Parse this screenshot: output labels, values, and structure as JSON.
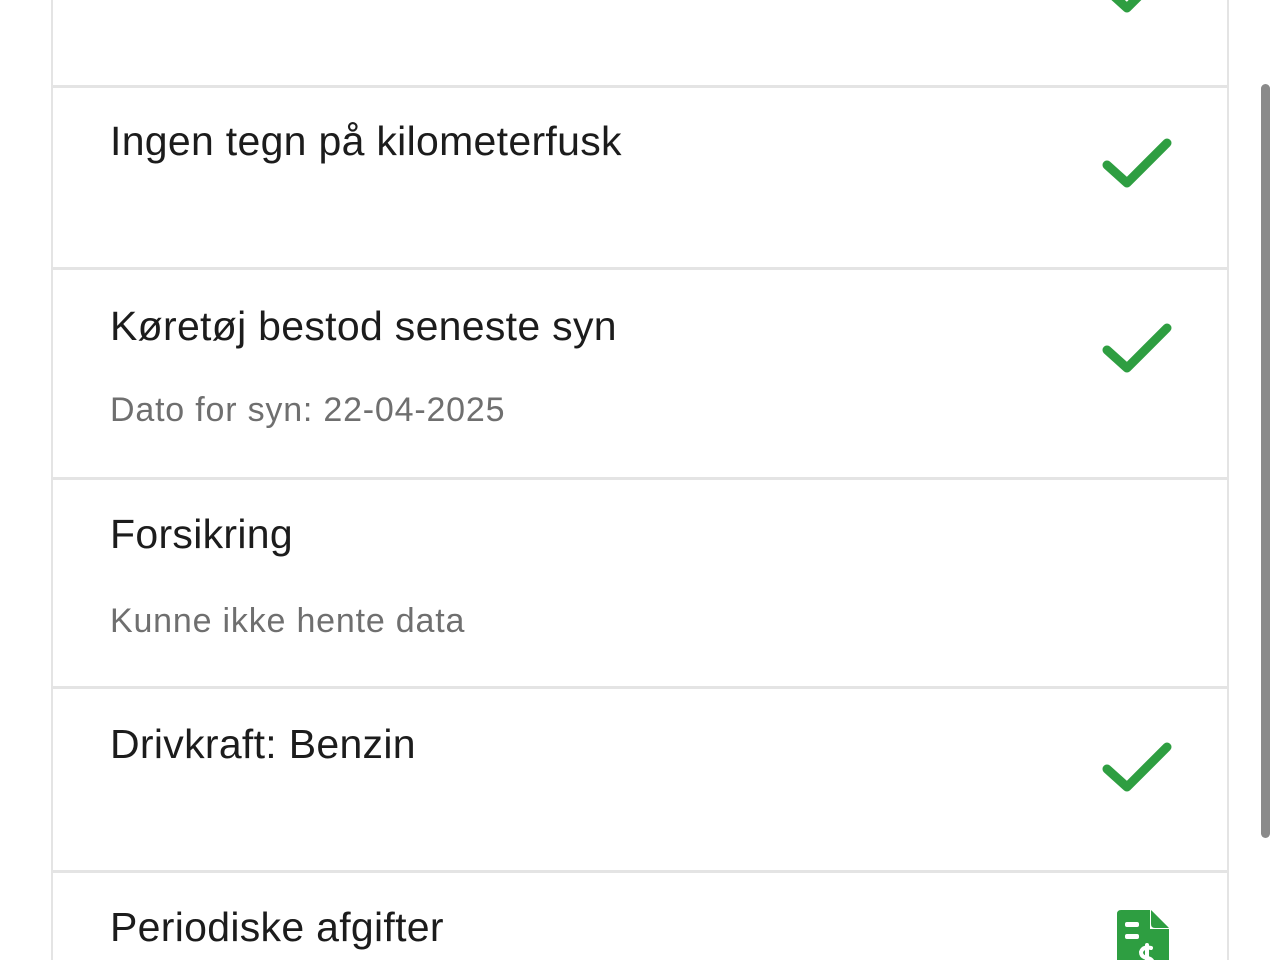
{
  "colors": {
    "check": "#2e9e41",
    "title_text": "#1c1c1c",
    "subtitle_text": "#6f6f6f",
    "divider": "#e4e4e4",
    "scrollbar": "#8a8a8a"
  },
  "rows": [
    {
      "title": "",
      "subtitle": "",
      "icon": "check-icon"
    },
    {
      "title": "Ingen tegn på kilometerfusk",
      "subtitle": "",
      "icon": "check-icon"
    },
    {
      "title": "Køretøj bestod seneste syn",
      "subtitle": "Dato for syn: 22-04-2025",
      "icon": "check-icon"
    },
    {
      "title": "Forsikring",
      "subtitle": "Kunne ikke hente data",
      "icon": ""
    },
    {
      "title": "Drivkraft: Benzin",
      "subtitle": "",
      "icon": "check-icon"
    },
    {
      "title": "Periodiske afgifter",
      "subtitle": "",
      "icon": "invoice-dollar-icon"
    }
  ]
}
